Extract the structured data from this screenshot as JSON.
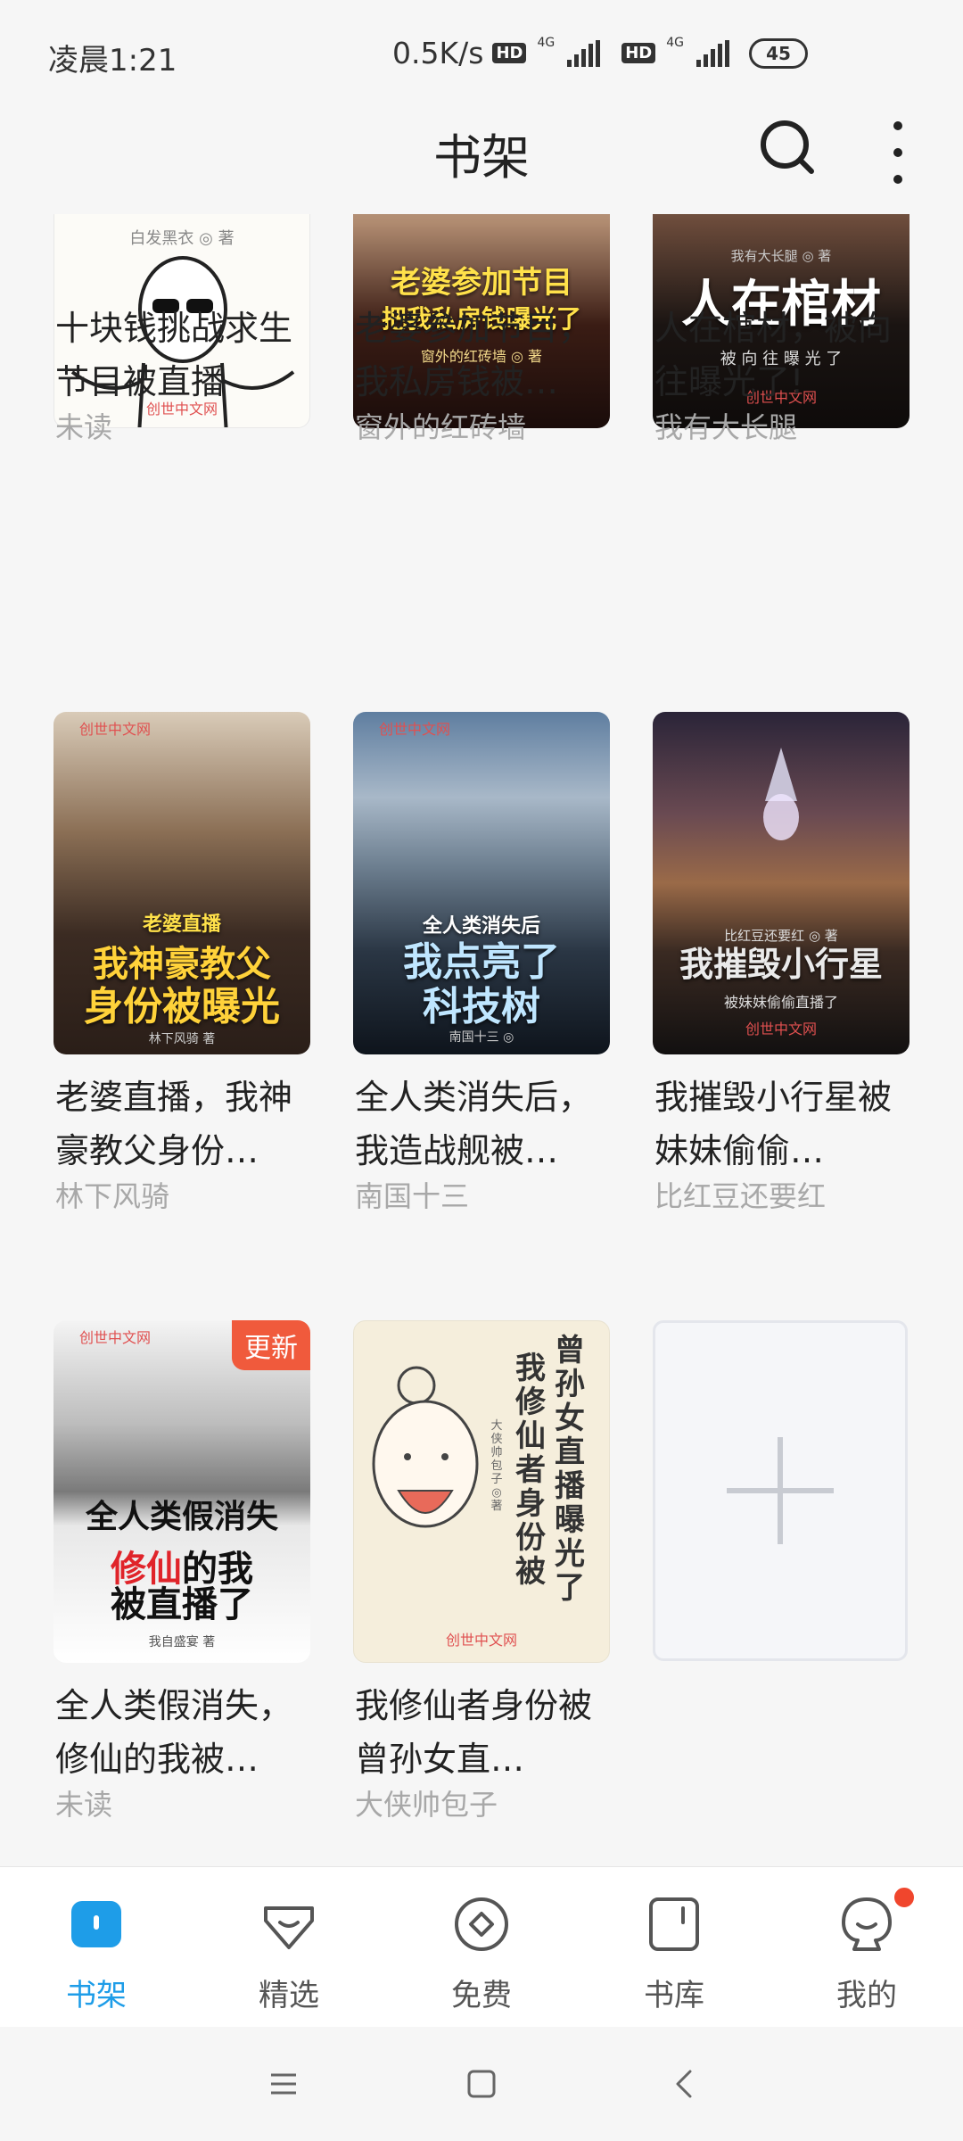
{
  "status_bar": {
    "time": "凌晨1:21",
    "speed": "0.5K/s",
    "hd1": "HD",
    "net1": "4G",
    "hd2": "HD",
    "net2": "4G",
    "battery": "45"
  },
  "header": {
    "title": "书架",
    "search_icon": "search-icon",
    "more_icon": "more-vertical-icon"
  },
  "books": [
    {
      "title": "十块钱挑战求生节目被直播",
      "status": "未读",
      "cover": {
        "small": "白发黑衣 ◎ 著",
        "brand": "创世中文网"
      }
    },
    {
      "title": "老婆参加节目，我私房钱被…",
      "status": "窗外的红砖墙",
      "cover": {
        "line1": "老婆参加节目",
        "line2": "把我私房钱曝光了",
        "small": "窗外的红砖墙 ◎ 著"
      }
    },
    {
      "title": "人在棺材，被向往曝光了!",
      "status": "我有大长腿",
      "cover": {
        "small": "我有大长腿 ◎ 著",
        "line1": "人在棺材",
        "line2": "被 向 往 曝 光 了",
        "brand": "创世中文网"
      }
    },
    {
      "title": "老婆直播，我神豪教父身份…",
      "status": "林下风骑",
      "cover": {
        "brand": "创世中文网",
        "tag": "老婆直播",
        "line1": "我神豪教父",
        "line2": "身份被曝光",
        "small": "林下风骑 著"
      }
    },
    {
      "title": "全人类消失后，我造战舰被…",
      "status": "南国十三",
      "cover": {
        "brand": "创世中文网",
        "tag": "全人类消失后",
        "line1": "我点亮了",
        "line2": "科技树",
        "small": "南国十三 ◎"
      }
    },
    {
      "title": "我摧毁小行星被妹妹偷偷…",
      "status": "比红豆还要红",
      "cover": {
        "small": "比红豆还要红 ◎ 著",
        "line1": "我摧毁小行星",
        "line2": "被妹妹偷偷直播了",
        "brand": "创世中文网"
      }
    },
    {
      "title": "全人类假消失，修仙的我被…",
      "status": "未读",
      "badge": "更新",
      "cover": {
        "brand": "创世中文网",
        "line1": "全人类假消失",
        "line2": "修仙",
        "line2b": "的我",
        "line3": "被直播了",
        "small": "我自盛宴 著"
      }
    },
    {
      "title": "我修仙者身份被曾孙女直…",
      "status": "大侠帅包子",
      "cover": {
        "col1": "曾孙女直播曝光了",
        "col2": "我修仙者身份被",
        "small": "大侠帅包子 ◎ 著",
        "brand": "创世中文网"
      }
    }
  ],
  "nav": [
    {
      "label": "书架",
      "icon": "bookshelf-icon",
      "active": true
    },
    {
      "label": "精选",
      "icon": "gem-icon"
    },
    {
      "label": "免费",
      "icon": "free-icon"
    },
    {
      "label": "书库",
      "icon": "library-icon"
    },
    {
      "label": "我的",
      "icon": "profile-icon",
      "has_dot": true
    }
  ],
  "system_nav": [
    "menu-icon",
    "home-icon",
    "back-icon"
  ],
  "colors": {
    "accent": "#1e9de8",
    "badge": "#f05a3c",
    "notification": "#f0462d"
  }
}
